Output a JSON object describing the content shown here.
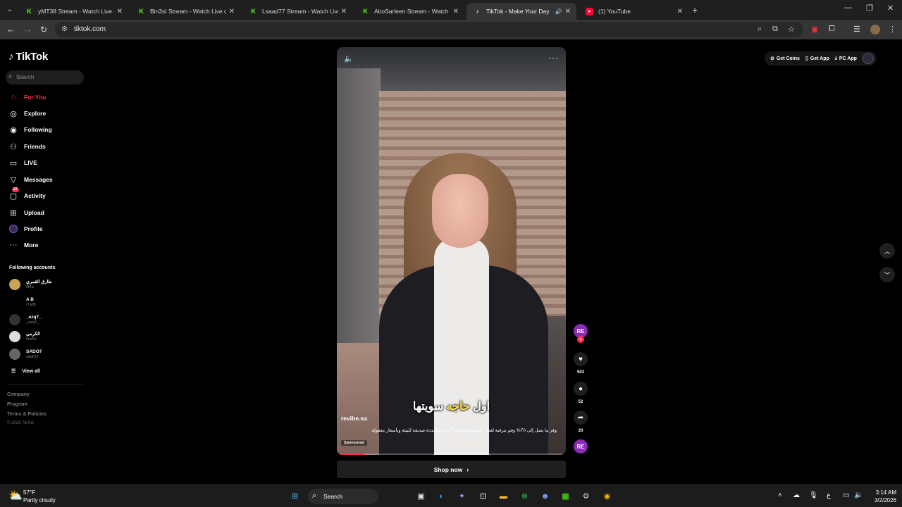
{
  "browser": {
    "tabs": [
      {
        "label": "yMT38 Stream - Watch Live on",
        "favicon": "kick-icon"
      },
      {
        "label": "Bin3sI Stream - Watch Live on K",
        "favicon": "kick-icon"
      },
      {
        "label": "Lsaad77 Stream - Watch Live on",
        "favicon": "kick-icon"
      },
      {
        "label": "AboSarleen Stream - Watch Live",
        "favicon": "kick-icon"
      },
      {
        "label": "TikTok - Make Your Day",
        "favicon": "tiktok-icon",
        "active": true
      },
      {
        "label": "(1) YouTube",
        "favicon": "youtube-icon"
      }
    ],
    "url": "tiktok.com"
  },
  "sidebar": {
    "logo": "TikTok",
    "search_placeholder": "Search",
    "nav": [
      {
        "label": "For You",
        "icon": "home-icon",
        "active": true
      },
      {
        "label": "Explore",
        "icon": "compass-icon"
      },
      {
        "label": "Following",
        "icon": "following-icon"
      },
      {
        "label": "Friends",
        "icon": "friends-icon"
      },
      {
        "label": "LIVE",
        "icon": "live-icon"
      },
      {
        "label": "Messages",
        "icon": "send-icon"
      },
      {
        "label": "Activity",
        "icon": "inbox-icon",
        "badge": "22"
      },
      {
        "label": "Upload",
        "icon": "plus-square-icon"
      },
      {
        "label": "Profile",
        "icon": "profile-icon"
      },
      {
        "label": "More",
        "icon": "more-icon"
      }
    ],
    "following_title": "Following accounts",
    "accounts": [
      {
        "name": "طارق القمري",
        "handle": "8f4a"
      },
      {
        "name": "A B",
        "handle": "r7a35"
      },
      {
        "name": "_ezq7_",
        "handle": "_ezq7_"
      },
      {
        "name": "الكرمي",
        "handle": "fxtz60"
      },
      {
        "name": "SADO7",
        "handle": "sad071"
      }
    ],
    "view_all": "View all",
    "footer": [
      "Company",
      "Program",
      "Terms & Policies"
    ],
    "copyright": "© 2026 TikTok"
  },
  "video": {
    "caption_before": "اول ",
    "caption_highlight": "حاجه",
    "caption_after": " سويتها",
    "author": "revibe.sa",
    "description": "وفر ما يصل إلى 70% وقم بترقية لعتك التقنية باستخدام أجهزة متجددة صديقة للبيئة وبأسعار معقولة",
    "sponsored": "Sponsored",
    "progress": 0.12,
    "shop_label": "Shop now"
  },
  "rail": {
    "avatar_text": "RE",
    "likes": "503",
    "comments": "52",
    "shares": "20",
    "music_text": "RE"
  },
  "topbar": {
    "get_coins": "Get Coins",
    "get_app": "Get App",
    "pc_app": "PC App"
  },
  "taskbar": {
    "temp": "57°F",
    "weather": "Partly cloudy",
    "search": "Search",
    "time": "3:14 AM",
    "date": "3/2/2026"
  },
  "colors": {
    "accent": "#fe2c55",
    "caption_highlight": "#ffe14a",
    "kick_green": "#53fc18"
  }
}
